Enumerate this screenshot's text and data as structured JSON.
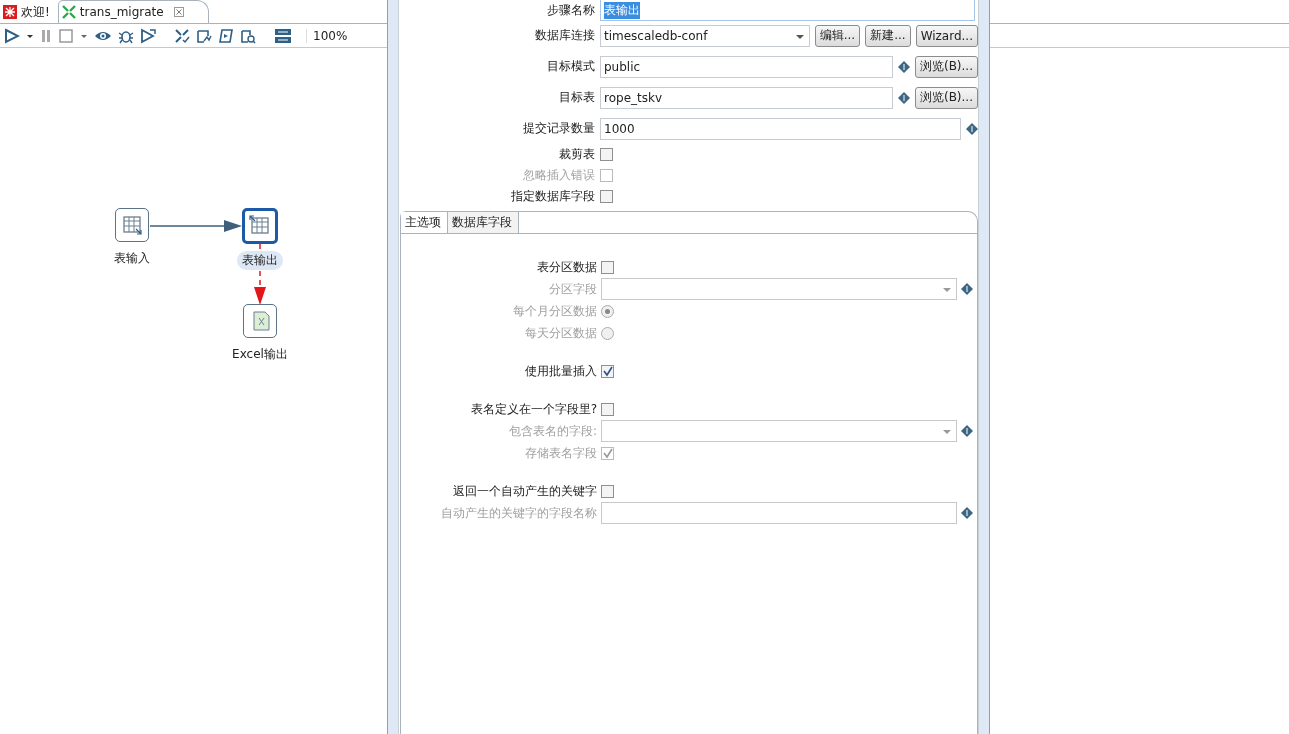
{
  "editor_tabs": [
    {
      "label": "欢迎!",
      "selected": false
    },
    {
      "label": "trans_migrate",
      "selected": true
    }
  ],
  "toolbar": {
    "zoom": "100%"
  },
  "canvas": {
    "nodes": [
      {
        "label": "表输入",
        "kind": "input",
        "selected": false
      },
      {
        "label": "表输出",
        "kind": "output",
        "selected": true
      },
      {
        "label": "Excel输出",
        "kind": "excel",
        "selected": false
      }
    ],
    "hops": [
      {
        "kind": "normal"
      },
      {
        "kind": "error"
      }
    ]
  },
  "dialog": {
    "fields": [
      {
        "kind": "text",
        "label": "步骤名称",
        "value": "表输出",
        "value_selected": true
      },
      {
        "kind": "combo",
        "label": "数据库连接",
        "value": "timescaledb-conf",
        "buttons": [
          "编辑...",
          "新建...",
          "Wizard..."
        ]
      },
      {
        "kind": "text",
        "label": "目标模式",
        "value": "public",
        "variable": true,
        "buttons": [
          "浏览(B)..."
        ]
      },
      {
        "kind": "text",
        "label": "目标表",
        "value": "rope_tskv",
        "variable": true,
        "buttons": [
          "浏览(B)..."
        ]
      },
      {
        "kind": "text",
        "label": "提交记录数量",
        "value": "1000",
        "variable": true
      },
      {
        "kind": "checkbox",
        "label": "裁剪表",
        "checked": false,
        "disabled": false
      },
      {
        "kind": "checkbox",
        "label": "忽略插入错误",
        "checked": false,
        "disabled": true
      },
      {
        "kind": "checkbox",
        "label": "指定数据库字段",
        "checked": false,
        "disabled": false
      }
    ],
    "tabs": [
      {
        "label": "主选项",
        "selected": true
      },
      {
        "label": "数据库字段",
        "selected": false
      }
    ],
    "groups": [
      [
        {
          "kind": "checkbox",
          "label": "表分区数据",
          "checked": false,
          "disabled": false
        },
        {
          "kind": "combo",
          "label": "分区字段",
          "variable": true,
          "disabled": true
        },
        {
          "kind": "radio",
          "label": "每个月分区数据",
          "selected": true,
          "disabled": true
        },
        {
          "kind": "radio",
          "label": "每天分区数据",
          "selected": false,
          "disabled": true
        }
      ],
      [
        {
          "kind": "checkbox",
          "label": "使用批量插入",
          "checked": true,
          "disabled": false
        }
      ],
      [
        {
          "kind": "checkbox",
          "label": "表名定义在一个字段里?",
          "checked": false,
          "disabled": false
        },
        {
          "kind": "combo",
          "label": "包含表名的字段:",
          "variable": true,
          "disabled": true
        },
        {
          "kind": "checkbox",
          "label": "存储表名字段",
          "checked": true,
          "disabled": true
        }
      ],
      [
        {
          "kind": "checkbox",
          "label": "返回一个自动产生的关键字",
          "checked": false,
          "disabled": false
        },
        {
          "kind": "text",
          "label": "自动产生的关键字的字段名称",
          "variable": true,
          "disabled": true
        }
      ]
    ]
  }
}
